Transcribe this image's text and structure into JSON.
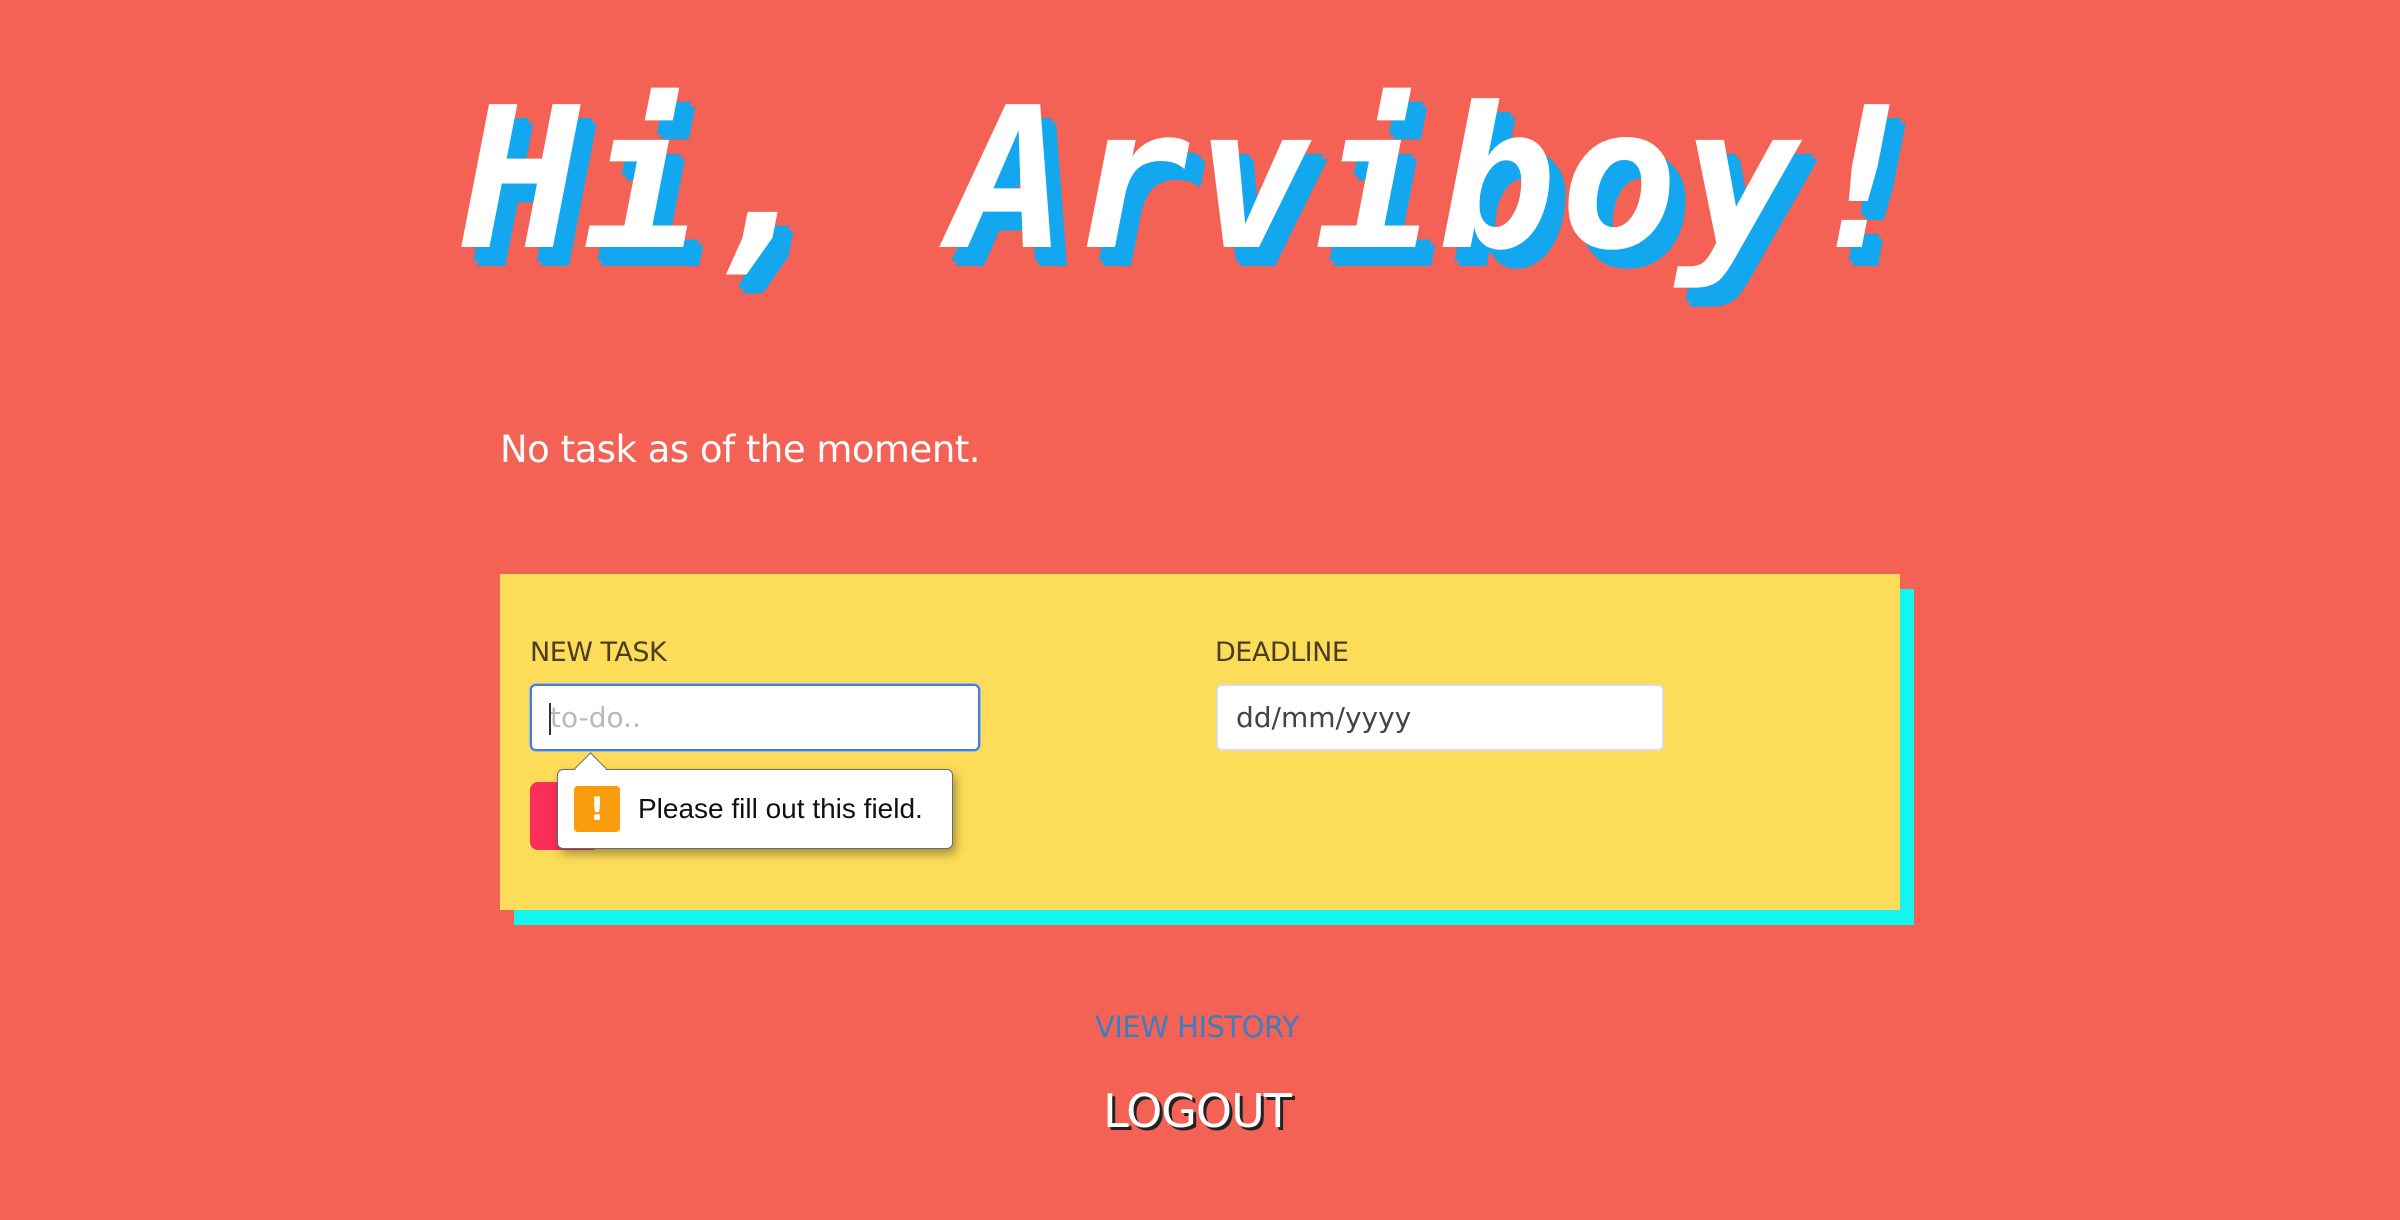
{
  "header": {
    "greeting": "Hi, Arviboy!"
  },
  "tasks": {
    "empty_message": "No task as of the moment."
  },
  "form": {
    "new_task_label": "NEW TASK",
    "new_task_placeholder": "to-do..",
    "deadline_label": "DEADLINE",
    "deadline_placeholder": "dd/mm/yyyy",
    "validation_message": "Please fill out this field.",
    "warning_glyph": "!"
  },
  "footer": {
    "view_history": "VIEW HISTORY",
    "logout": "LOGOUT"
  },
  "colors": {
    "background": "#f36255",
    "card": "#fddc59",
    "card_shadow": "#13f6ed",
    "greeting_shadow": "#12a7ee",
    "add_button": "#fb2e5a",
    "link": "#3c7fc1",
    "warning": "#f99c0e"
  }
}
